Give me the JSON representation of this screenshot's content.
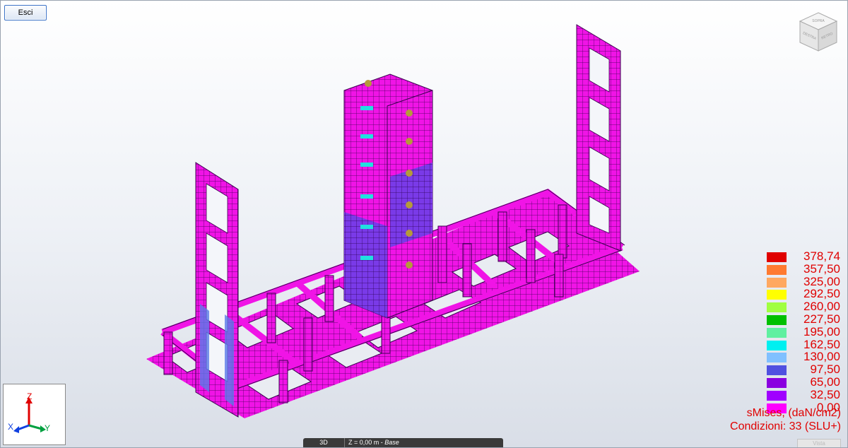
{
  "toolbar": {
    "exit_label": "Esci"
  },
  "nav_cube": {
    "top_label": "SOPRA",
    "left_label": "DESTRA",
    "right_label": "RETRO"
  },
  "axes": {
    "z": "Z",
    "x": "X",
    "y": "Y"
  },
  "legend": {
    "values": [
      "378,74",
      "357,50",
      "325,00",
      "292,50",
      "260,00",
      "227,50",
      "195,00",
      "162,50",
      "130,00",
      "97,50",
      "65,00",
      "32,50",
      "0,00"
    ],
    "colors": [
      "#e00000",
      "#ff7a30",
      "#ffa860",
      "#ffff00",
      "#a0ff40",
      "#00c000",
      "#60f0a0",
      "#00f0f0",
      "#80c0ff",
      "#5050e0",
      "#8a00e0",
      "#a000ff",
      "#ff00ff"
    ],
    "result_label": "sMises, (daN/cm2)",
    "combination_label": "Condizioni: 33 (SLU+)"
  },
  "statusbar": {
    "mode": "3D",
    "plane_prefix": "Z = 0,00 m - ",
    "plane_name": "Base"
  },
  "view_tab": "Vista"
}
